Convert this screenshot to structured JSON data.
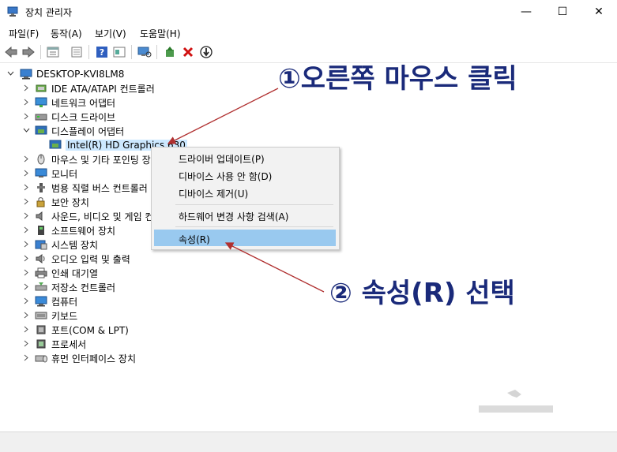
{
  "window": {
    "title": "장치 관리자",
    "minimize_glyph": "—",
    "maximize_glyph": "☐",
    "close_glyph": "✕"
  },
  "menu": [
    {
      "label": "파일(F)"
    },
    {
      "label": "동작(A)"
    },
    {
      "label": "보기(V)"
    },
    {
      "label": "도움말(H)"
    }
  ],
  "toolbar": {
    "icons": [
      "back-icon",
      "forward-icon",
      "properties-view-icon",
      "device-list-icon",
      "help-icon",
      "show-hidden-icon",
      "scan-hardware-icon",
      "update-driver-icon",
      "uninstall-icon",
      "disable-icon"
    ]
  },
  "tree": {
    "root": "DESKTOP-KVI8LM8",
    "categories": [
      {
        "label": "IDE ATA/ATAPI 컨트롤러",
        "icon": "ide-controller-icon"
      },
      {
        "label": "네트워크 어댑터",
        "icon": "network-adapter-icon"
      },
      {
        "label": "디스크 드라이브",
        "icon": "disk-drive-icon"
      },
      {
        "label": "디스플레이 어댑터",
        "icon": "display-adapter-icon",
        "expanded": true
      },
      {
        "label": "Intel(R) HD Graphics 630",
        "icon": "display-adapter-icon",
        "child": true
      },
      {
        "label": "마우스 및 기타 포인팅 장치",
        "icon": "mouse-icon"
      },
      {
        "label": "모니터",
        "icon": "monitor-icon"
      },
      {
        "label": "범용 직렬 버스 컨트롤러",
        "icon": "usb-icon"
      },
      {
        "label": "보안 장치",
        "icon": "security-device-icon"
      },
      {
        "label": "사운드, 비디오 및 게임 컨트롤러",
        "icon": "sound-icon"
      },
      {
        "label": "소프트웨어 장치",
        "icon": "software-device-icon"
      },
      {
        "label": "시스템 장치",
        "icon": "system-device-icon"
      },
      {
        "label": "오디오 입력 및 출력",
        "icon": "audio-io-icon"
      },
      {
        "label": "인쇄 대기열",
        "icon": "print-queue-icon"
      },
      {
        "label": "저장소 컨트롤러",
        "icon": "storage-controller-icon"
      },
      {
        "label": "컴퓨터",
        "icon": "computer-icon"
      },
      {
        "label": "키보드",
        "icon": "keyboard-icon"
      },
      {
        "label": "포트(COM & LPT)",
        "icon": "port-icon"
      },
      {
        "label": "프로세서",
        "icon": "processor-icon"
      },
      {
        "label": "휴먼 인터페이스 장치",
        "icon": "hid-icon"
      }
    ]
  },
  "context_menu": {
    "items": [
      {
        "label": "드라이버 업데이트(P)"
      },
      {
        "label": "디바이스 사용 안 함(D)"
      },
      {
        "label": "디바이스 제거(U)"
      },
      {
        "label": "하드웨어 변경 사항 검색(A)"
      },
      {
        "label": "속성(R)",
        "highlighted": true
      }
    ]
  },
  "annotations": {
    "step1": "①오른쪽 마우스 클릭",
    "step2": "② 속성(R) 선택"
  },
  "colors": {
    "annotation": "#1a2a7a",
    "arrow": "#b03030",
    "highlight": "#99c9ef",
    "selection": "#cce8ff"
  }
}
